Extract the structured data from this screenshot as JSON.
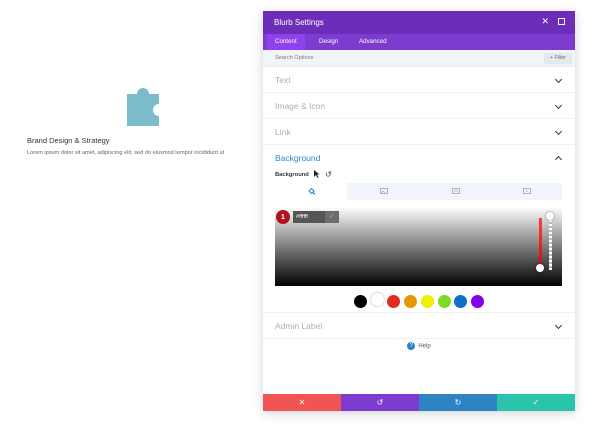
{
  "preview": {
    "icon": "puzzle-piece-icon",
    "icon_color": "#7bbcc9",
    "title": "Brand Design & Strategy",
    "body": "Lorem ipsum dolor sit amet, adipiscing elit, sed do eiusmod tempor incididunt ut"
  },
  "modal": {
    "title": "Blurb Settings",
    "close_icon": "close-icon",
    "expand_icon": "expand-icon",
    "tabs": [
      {
        "label": "Content",
        "active": true
      },
      {
        "label": "Design",
        "active": false
      },
      {
        "label": "Advanced",
        "active": false
      }
    ],
    "search_placeholder": "Search Options",
    "filter_label": "+ Filter",
    "sections": [
      {
        "label": "Text"
      },
      {
        "label": "Image & Icon"
      },
      {
        "label": "Link"
      }
    ],
    "background": {
      "title": "Background",
      "sub_label": "Background",
      "bg_tabs": [
        "paint-bucket-icon",
        "image-icon",
        "video-icon",
        "pattern-icon"
      ],
      "hex_value": "#ffffff",
      "badge": "1",
      "swatches": [
        "#000000",
        "#ffffff",
        "#e02b20",
        "#e09900",
        "#edf000",
        "#7cda24",
        "#0c71c3",
        "#8300e9"
      ]
    },
    "admin_label": "Admin Label",
    "help_label": "Help",
    "footer": [
      {
        "name": "cancel",
        "icon": "✕",
        "color": "#ef5555"
      },
      {
        "name": "undo",
        "icon": "↺",
        "color": "#7e3bd0"
      },
      {
        "name": "redo",
        "icon": "↻",
        "color": "#2e83c5"
      },
      {
        "name": "save",
        "icon": "✓",
        "color": "#29c4a9"
      }
    ]
  },
  "colors": {
    "header_purple": "#6c2eb9",
    "tab_purple": "#7e3bd0",
    "active_blue": "#2e83c5"
  }
}
